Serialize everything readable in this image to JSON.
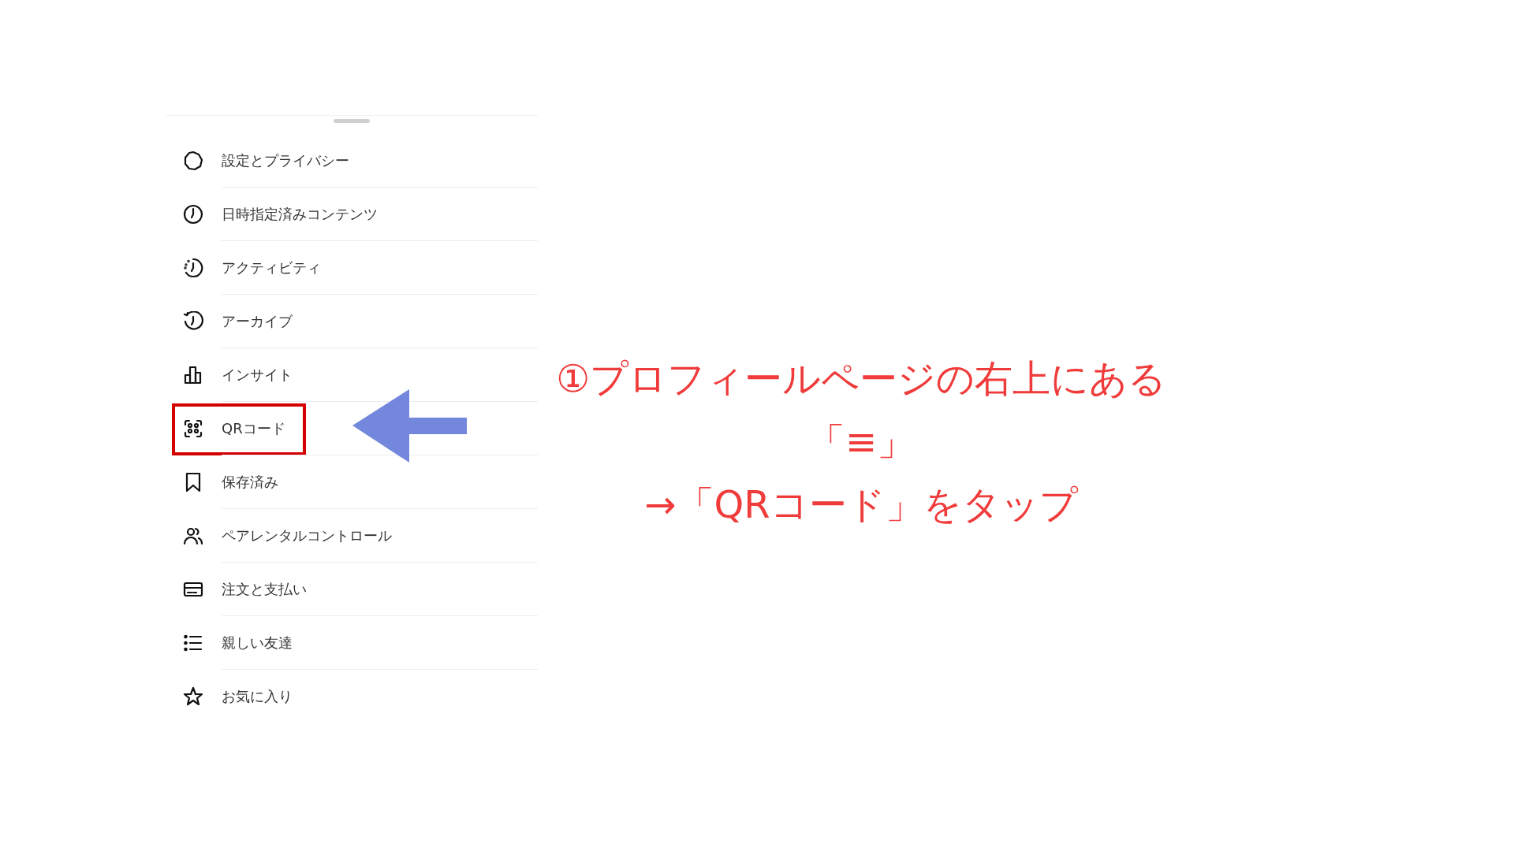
{
  "menu": {
    "items": [
      {
        "label": "設定とプライバシー",
        "highlighted": false
      },
      {
        "label": "日時指定済みコンテンツ",
        "highlighted": false
      },
      {
        "label": "アクティビティ",
        "highlighted": false
      },
      {
        "label": "アーカイブ",
        "highlighted": false
      },
      {
        "label": "インサイト",
        "highlighted": false
      },
      {
        "label": "QRコード",
        "highlighted": true
      },
      {
        "label": "保存済み",
        "highlighted": false
      },
      {
        "label": "ペアレンタルコントロール",
        "highlighted": false
      },
      {
        "label": "注文と支払い",
        "highlighted": false
      },
      {
        "label": "親しい友達",
        "highlighted": false
      },
      {
        "label": "お気に入り",
        "highlighted": false
      }
    ]
  },
  "annotation": {
    "lines": [
      "①プロフィールページの右上にある",
      "「≡」",
      "→「QRコード」をタップ"
    ]
  }
}
